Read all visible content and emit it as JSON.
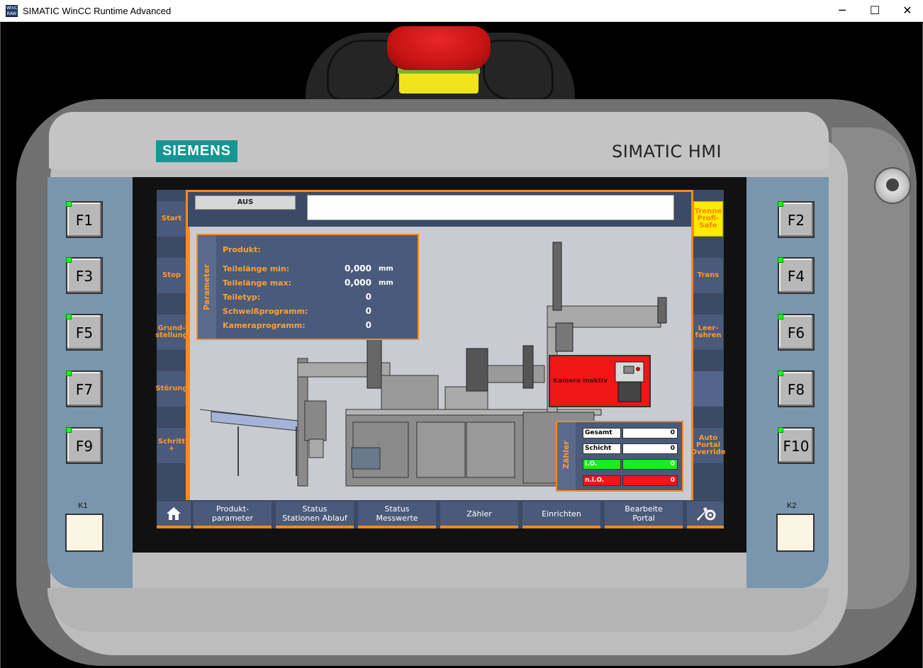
{
  "window": {
    "icon_text": "WinCC RAW",
    "title": "SIMATIC WinCC Runtime Advanced",
    "minimize": "─",
    "maximize": "☐",
    "close": "✕"
  },
  "device": {
    "brand": "SIEMENS",
    "model": "SIMATIC HMI",
    "fkeys": [
      "F1",
      "F2",
      "F3",
      "F4",
      "F5",
      "F6",
      "F7",
      "F8",
      "F9",
      "F10"
    ],
    "k_labels": [
      "K1",
      "K2"
    ]
  },
  "left_softkeys": [
    "Start",
    "Stop",
    "Grund-\nstellung",
    "Störung",
    "Schritt\n+"
  ],
  "right_softkeys": [
    "Trenne\nProfi-\nSafe",
    "Trans",
    "Leer-\nfahren",
    "",
    "Auto\nPortal\nOverride"
  ],
  "header": {
    "mode": "AUS",
    "message": ""
  },
  "parameter": {
    "title": "Parameter",
    "product_label": "Produkt:",
    "rows": [
      {
        "label": "Teilelänge min:",
        "value": "0,000",
        "unit": "mm"
      },
      {
        "label": "Teilelänge max:",
        "value": "0,000",
        "unit": "mm"
      },
      {
        "label": "Teiletyp:",
        "value": "0",
        "unit": ""
      },
      {
        "label": "Schweißprogramm:",
        "value": "0",
        "unit": ""
      },
      {
        "label": "Kameraprogramm:",
        "value": "0",
        "unit": ""
      }
    ]
  },
  "camera": {
    "status": "Kamera inaktiv"
  },
  "counter": {
    "title": "Zähler",
    "rows": [
      {
        "label": "Gesamt",
        "value": "0"
      },
      {
        "label": "Schicht",
        "value": "0"
      },
      {
        "label": "i.O.",
        "value": "0"
      },
      {
        "label": "n.i.O.",
        "value": "0"
      }
    ]
  },
  "nav": {
    "home": "home-icon",
    "items": [
      "Produkt-\nparameter",
      "Status\nStationen Ablauf",
      "Status\nMesswerte",
      "Zähler",
      "Einrichten",
      "Bearbeite\nPortal"
    ],
    "settings": "settings-icon"
  },
  "colors": {
    "accent": "#ff8a1c",
    "panel": "#4a5a7a",
    "ok": "#1aee1a",
    "nok": "#ee1616"
  }
}
